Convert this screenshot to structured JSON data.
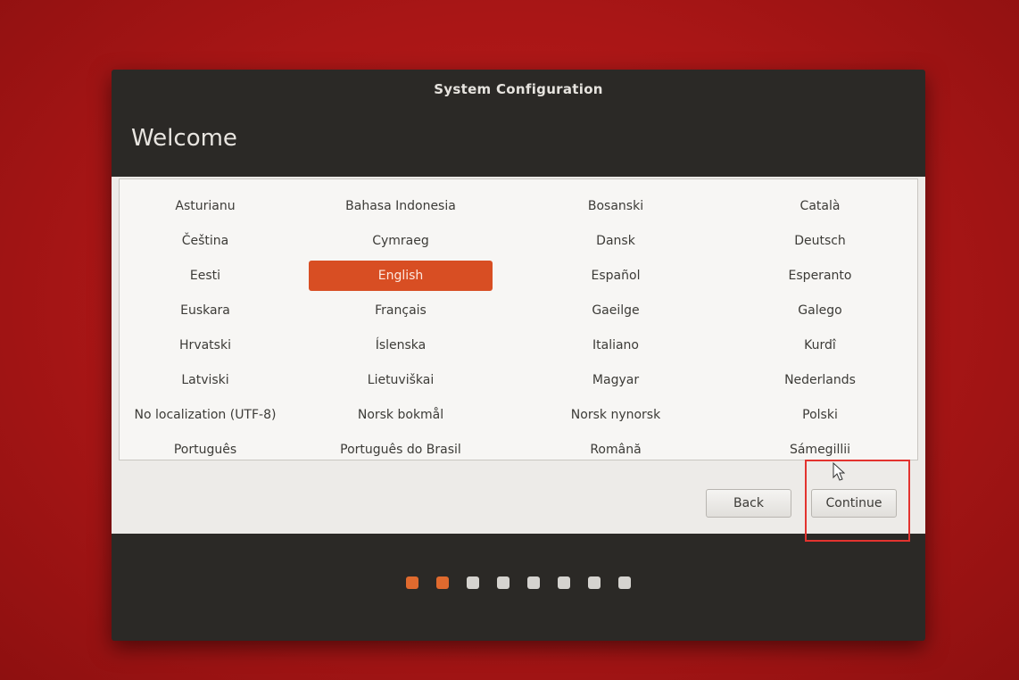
{
  "window": {
    "title": "System Configuration",
    "heading": "Welcome"
  },
  "languages": [
    "Asturianu",
    "Bahasa Indonesia",
    "Bosanski",
    "Català",
    "Čeština",
    "Cymraeg",
    "Dansk",
    "Deutsch",
    "Eesti",
    "English",
    "Español",
    "Esperanto",
    "Euskara",
    "Français",
    "Gaeilge",
    "Galego",
    "Hrvatski",
    "Íslenska",
    "Italiano",
    "Kurdî",
    "Latviski",
    "Lietuviškai",
    "Magyar",
    "Nederlands",
    "No localization (UTF-8)",
    "Norsk bokmål",
    "Norsk nynorsk",
    "Polski",
    "Português",
    "Português do Brasil",
    "Română",
    "Sámegillii"
  ],
  "selected_language": "English",
  "buttons": {
    "back": "Back",
    "continue": "Continue"
  },
  "progress": {
    "total_steps": 8,
    "completed_steps": 2
  },
  "colors": {
    "accent": "#d84e23",
    "active_dot": "#e06a2e",
    "highlight": "#e3332f"
  }
}
